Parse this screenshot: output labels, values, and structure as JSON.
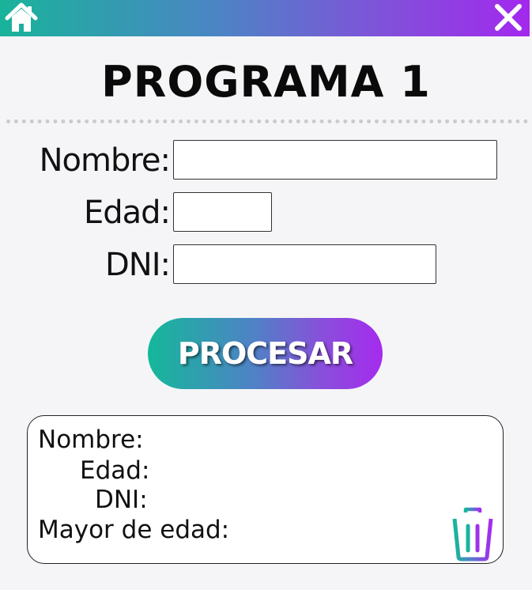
{
  "header": {
    "home_icon": "home-icon",
    "close_icon": "close-icon",
    "gradient_start": "#19b39a",
    "gradient_end": "#a328ee"
  },
  "title": "PROGRAMA 1",
  "form": {
    "nombre_label": "Nombre:",
    "nombre_value": "",
    "edad_label": "Edad:",
    "edad_value": "",
    "dni_label": "DNI:",
    "dni_value": ""
  },
  "process_button": "PROCESAR",
  "result": {
    "nombre_label": "Nombre:",
    "edad_label": "Edad:",
    "dni_label": "DNI:",
    "mayor_label": "Mayor de edad:",
    "trash_icon": "trash-icon"
  }
}
